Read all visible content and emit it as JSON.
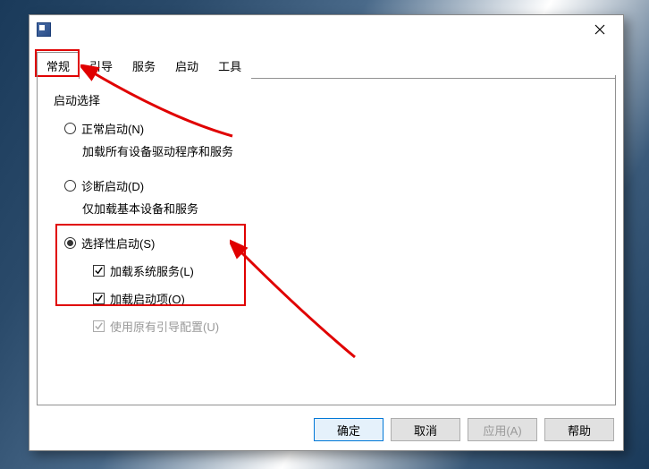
{
  "tabs": {
    "general": "常规",
    "boot": "引导",
    "services": "服务",
    "startup": "启动",
    "tools": "工具"
  },
  "group": {
    "title": "启动选择",
    "normal": {
      "label": "正常启动(N)",
      "desc": "加载所有设备驱动程序和服务"
    },
    "diagnostic": {
      "label": "诊断启动(D)",
      "desc": "仅加载基本设备和服务"
    },
    "selective": {
      "label": "选择性启动(S)"
    },
    "loadservices": "加载系统服务(L)",
    "loadstartup": "加载启动项(O)",
    "originalboot": "使用原有引导配置(U)"
  },
  "buttons": {
    "ok": "确定",
    "cancel": "取消",
    "apply": "应用(A)",
    "help": "帮助"
  }
}
